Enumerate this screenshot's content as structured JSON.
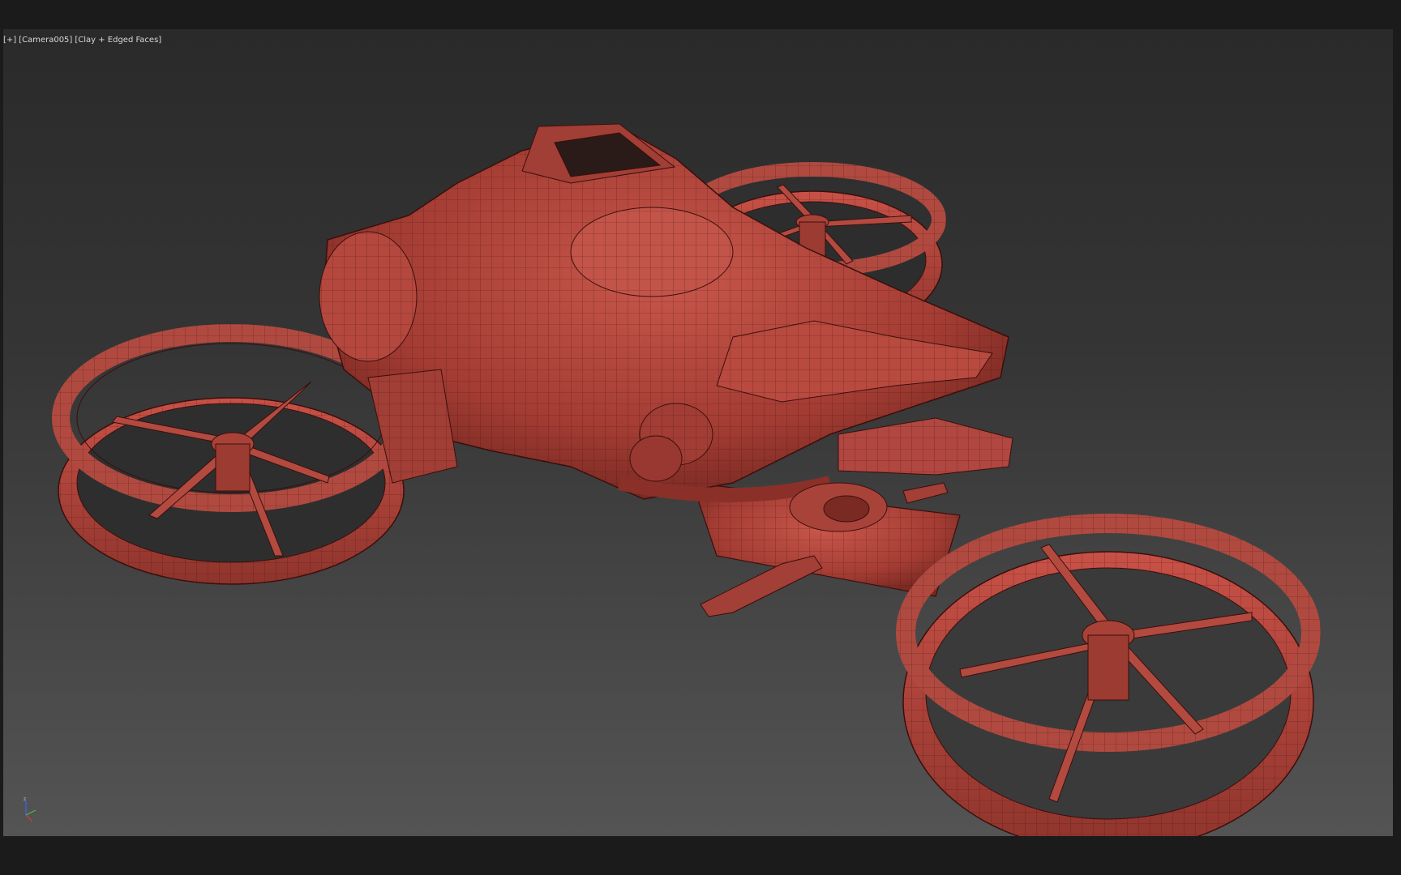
{
  "viewport": {
    "label_plus": "[+]",
    "label_camera": "[Camera005]",
    "label_shading": "[Clay + Edged Faces]"
  },
  "scene": {
    "object": "hoverbike-model",
    "material_color": "#b8473e",
    "wire_color": "#3a0f0c"
  },
  "gizmo": {
    "axis_z": "z",
    "colors": {
      "x": "#d04040",
      "y": "#40c040",
      "z": "#4060ff"
    }
  }
}
